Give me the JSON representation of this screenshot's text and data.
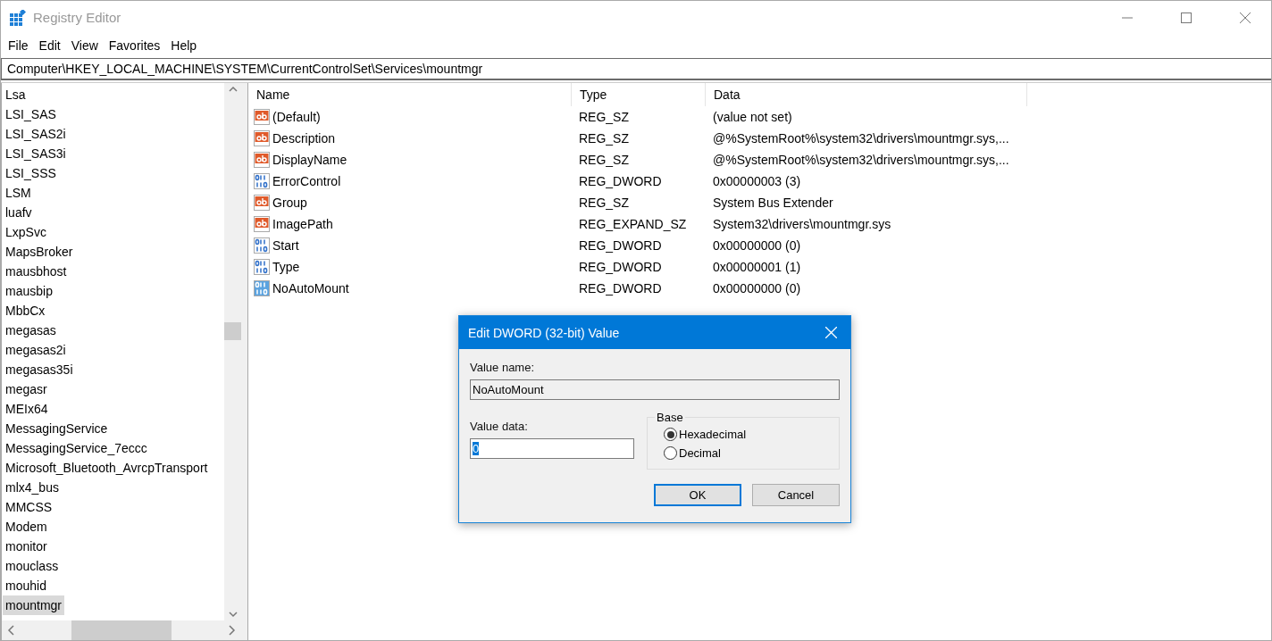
{
  "window": {
    "title": "Registry Editor"
  },
  "menu": [
    "File",
    "Edit",
    "View",
    "Favorites",
    "Help"
  ],
  "address": "Computer\\HKEY_LOCAL_MACHINE\\SYSTEM\\CurrentControlSet\\Services\\mountmgr",
  "tree": {
    "items": [
      {
        "label": "Lsa",
        "selected": false
      },
      {
        "label": "LSI_SAS",
        "selected": false
      },
      {
        "label": "LSI_SAS2i",
        "selected": false
      },
      {
        "label": "LSI_SAS3i",
        "selected": false
      },
      {
        "label": "LSI_SSS",
        "selected": false
      },
      {
        "label": "LSM",
        "selected": false
      },
      {
        "label": "luafv",
        "selected": false
      },
      {
        "label": "LxpSvc",
        "selected": false
      },
      {
        "label": "MapsBroker",
        "selected": false
      },
      {
        "label": "mausbhost",
        "selected": false
      },
      {
        "label": "mausbip",
        "selected": false
      },
      {
        "label": "MbbCx",
        "selected": false
      },
      {
        "label": "megasas",
        "selected": false
      },
      {
        "label": "megasas2i",
        "selected": false
      },
      {
        "label": "megasas35i",
        "selected": false
      },
      {
        "label": "megasr",
        "selected": false
      },
      {
        "label": "MEIx64",
        "selected": false
      },
      {
        "label": "MessagingService",
        "selected": false
      },
      {
        "label": "MessagingService_7eccc",
        "selected": false
      },
      {
        "label": "Microsoft_Bluetooth_AvrcpTransport",
        "selected": false
      },
      {
        "label": "mlx4_bus",
        "selected": false
      },
      {
        "label": "MMCSS",
        "selected": false
      },
      {
        "label": "Modem",
        "selected": false
      },
      {
        "label": "monitor",
        "selected": false
      },
      {
        "label": "mouclass",
        "selected": false
      },
      {
        "label": "mouhid",
        "selected": false
      },
      {
        "label": "mountmgr",
        "selected": true
      }
    ]
  },
  "values": {
    "columns": [
      "Name",
      "Type",
      "Data"
    ],
    "rows": [
      {
        "kind": "string",
        "name": "(Default)",
        "type": "REG_SZ",
        "data": "(value not set)",
        "selected": false
      },
      {
        "kind": "string",
        "name": "Description",
        "type": "REG_SZ",
        "data": "@%SystemRoot%\\system32\\drivers\\mountmgr.sys,...",
        "selected": false
      },
      {
        "kind": "string",
        "name": "DisplayName",
        "type": "REG_SZ",
        "data": "@%SystemRoot%\\system32\\drivers\\mountmgr.sys,...",
        "selected": false
      },
      {
        "kind": "binary",
        "name": "ErrorControl",
        "type": "REG_DWORD",
        "data": "0x00000003 (3)",
        "selected": false
      },
      {
        "kind": "string",
        "name": "Group",
        "type": "REG_SZ",
        "data": "System Bus Extender",
        "selected": false
      },
      {
        "kind": "string",
        "name": "ImagePath",
        "type": "REG_EXPAND_SZ",
        "data": "System32\\drivers\\mountmgr.sys",
        "selected": false
      },
      {
        "kind": "binary",
        "name": "Start",
        "type": "REG_DWORD",
        "data": "0x00000000 (0)",
        "selected": false
      },
      {
        "kind": "binary",
        "name": "Type",
        "type": "REG_DWORD",
        "data": "0x00000001 (1)",
        "selected": false
      },
      {
        "kind": "binary",
        "name": "NoAutoMount",
        "type": "REG_DWORD",
        "data": "0x00000000 (0)",
        "selected": true
      }
    ]
  },
  "dialog": {
    "title": "Edit DWORD (32-bit) Value",
    "value_name_label": "Value name:",
    "value_name": "NoAutoMount",
    "value_data_label": "Value data:",
    "value_data": "0",
    "base_label": "Base",
    "bases": [
      {
        "label": "Hexadecimal",
        "selected": true
      },
      {
        "label": "Decimal",
        "selected": false
      }
    ],
    "buttons": [
      {
        "label": "OK",
        "default": true
      },
      {
        "label": "Cancel",
        "default": false
      }
    ]
  }
}
